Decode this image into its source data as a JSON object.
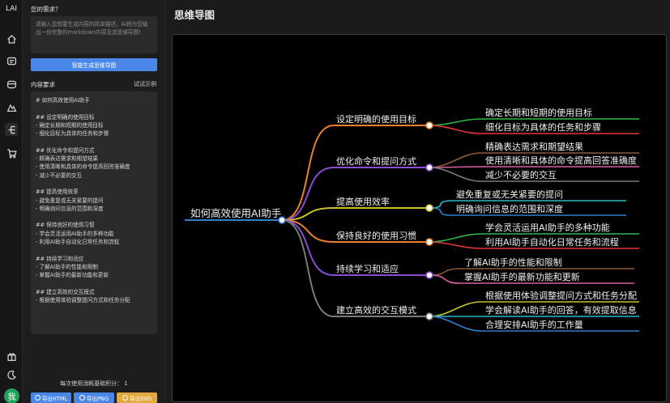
{
  "app": {
    "logo": "LAI",
    "avatar": "我"
  },
  "rail": {
    "icons": [
      {
        "name": "home-icon",
        "active": false
      },
      {
        "name": "chat-icon",
        "active": false
      },
      {
        "name": "box-icon",
        "active": false
      },
      {
        "name": "chart-icon",
        "active": false
      },
      {
        "name": "mindmap-icon",
        "active": true
      },
      {
        "name": "cart-icon",
        "active": false
      }
    ],
    "bottom_icons": [
      "gift-icon",
      "moon-icon"
    ]
  },
  "panel": {
    "requirement_label": "您的需求？",
    "requirement_placeholder": "请输入您想要生成内容的简单描述，AI将为您输出一份完整的markdown内容及其思维导图!",
    "generate_button": "智能生成思维导图",
    "content_label": "内容要求",
    "example_link": "试试示例",
    "markdown_lines": [
      "# 如何高效使用AI助手",
      "",
      "## 设定明确的使用目标",
      "- 确定长期和短期的使用目标",
      "- 细化目标为具体的任务和步骤",
      "",
      "## 优化命令和提问方式",
      "- 精确表达需求和期望结果",
      "- 使用清晰和具体的命令提高回答准确度",
      "- 减少不必要的交互",
      "",
      "## 提高使用效率",
      "- 避免重复或无关紧要的提问",
      "- 明确询问信息的范围和深度",
      "",
      "## 保持良好的使用习惯",
      "- 学会灵活运用AI助手的多种功能",
      "- 利用AI助手自动化日常任务和流程",
      "",
      "## 持续学习和适应",
      "- 了解AI助手的性能和限制",
      "- 掌握AI助手的最新功能和更新",
      "",
      "## 建立高效的交互模式",
      "- 根据使用体验调整提问方式和任务分配"
    ],
    "cost_text": "每次使用消耗基础积分： 1",
    "export_html": "导出HTML",
    "export_png": "导出PNG",
    "export_svg": "导出SVG"
  },
  "main": {
    "title": "思维导图"
  },
  "mindmap": {
    "root": "如何高效使用AI助手",
    "branches": [
      {
        "label": "设定明确的使用目标",
        "color": "#e8822e",
        "children": [
          {
            "label": "确定长期和短期的使用目标",
            "color": "#2fb84a"
          },
          {
            "label": "细化目标为具体的任务和步骤",
            "color": "#e8343c"
          }
        ]
      },
      {
        "label": "优化命令和提问方式",
        "color": "#8a4cd1",
        "children": [
          {
            "label": "精确表达需求和期望结果",
            "color": "#8b5a3c"
          },
          {
            "label": "使用清晰和具体的命令提高回答准确度",
            "color": "#d85ba0"
          },
          {
            "label": "减少不必要的交互",
            "color": "#7a7a7a"
          }
        ]
      },
      {
        "label": "提高使用效率",
        "color": "#c8c02a",
        "children": [
          {
            "label": "避免重复或无关紧要的提问",
            "color": "#2ab8d0"
          },
          {
            "label": "明确询问信息的范围和深度",
            "color": "#2f7fc8"
          }
        ]
      },
      {
        "label": "保持良好的使用习惯",
        "color": "#e8822e",
        "children": [
          {
            "label": "学会灵活运用AI助手的多种功能",
            "color": "#2fb84a"
          },
          {
            "label": "利用AI助手自动化日常任务和流程",
            "color": "#e8343c"
          }
        ]
      },
      {
        "label": "持续学习和适应",
        "color": "#8a4cd1",
        "children": [
          {
            "label": "了解AI助手的性能和限制",
            "color": "#8b5a3c"
          },
          {
            "label": "掌握AI助手的最新功能和更新",
            "color": "#d85ba0"
          }
        ]
      },
      {
        "label": "建立高效的交互模式",
        "color": "#7a7a7a",
        "children": [
          {
            "label": "根据使用体验调整提问方式和任务分配",
            "color": "#c8c02a"
          },
          {
            "label": "学会解读AI助手的回答，有效提取信息",
            "color": "#2ab8d0"
          },
          {
            "label": "合理安排AI助手的工作量",
            "color": "#2f7fc8"
          }
        ]
      }
    ],
    "root_color": "#2f7fc8"
  }
}
